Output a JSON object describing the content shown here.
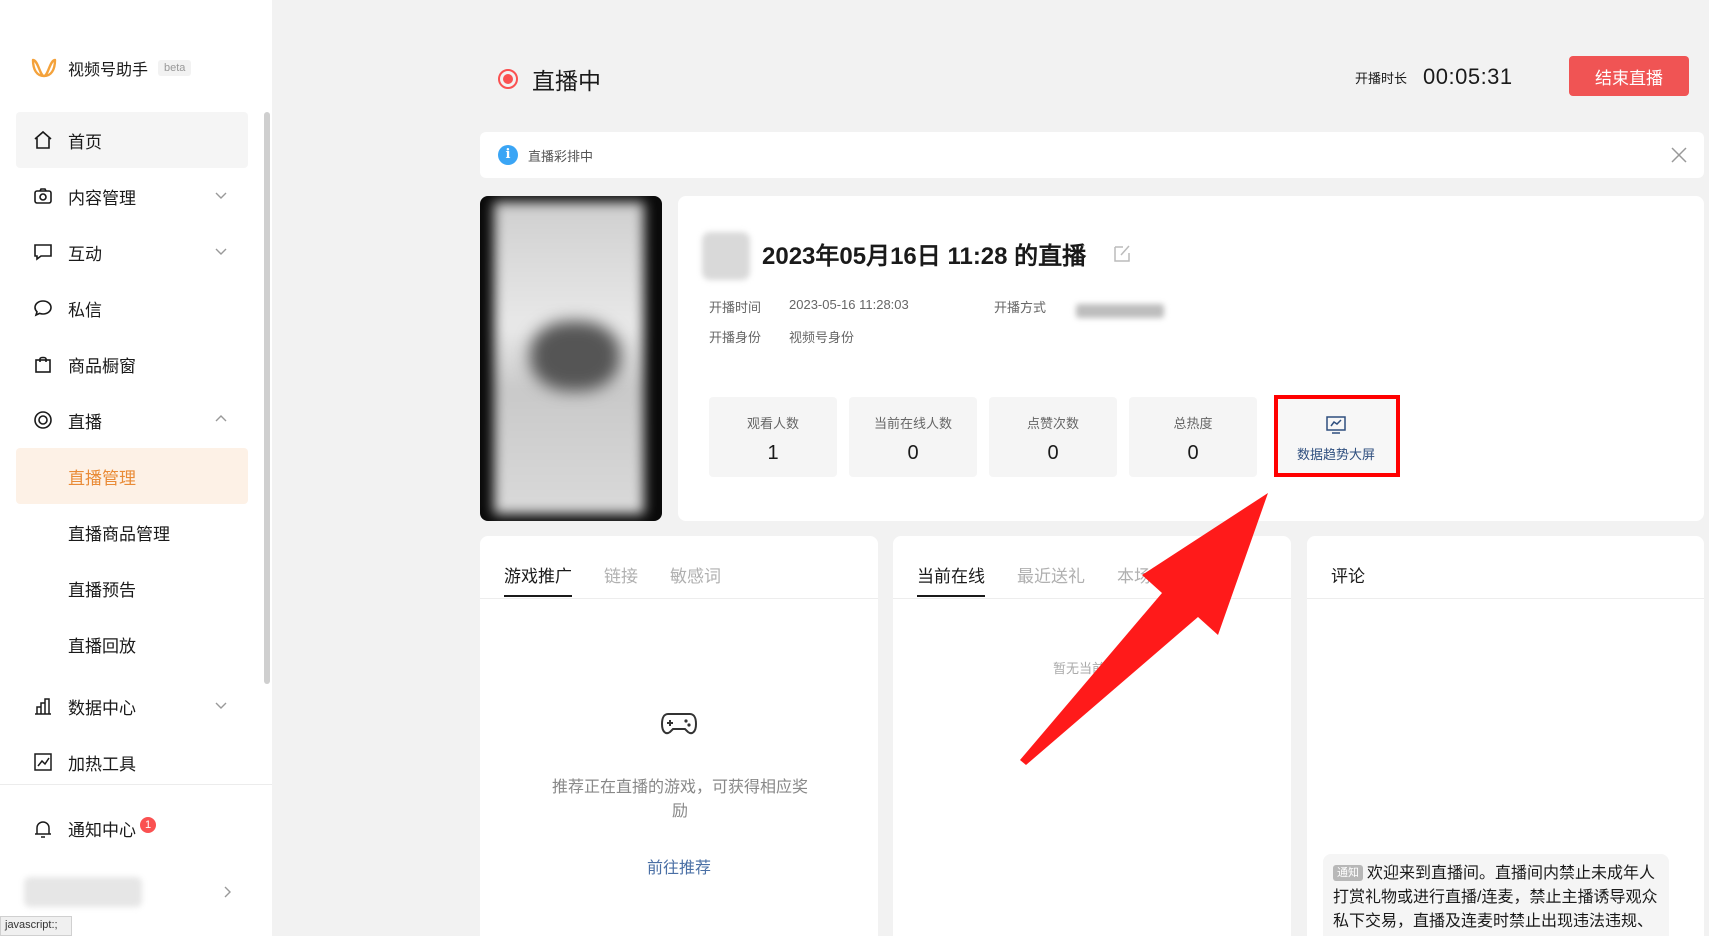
{
  "brand": {
    "name": "视频号助手",
    "beta": "beta"
  },
  "sidebar": {
    "items": [
      {
        "label": "首页"
      },
      {
        "label": "内容管理"
      },
      {
        "label": "互动"
      },
      {
        "label": "私信"
      },
      {
        "label": "商品橱窗"
      },
      {
        "label": "直播"
      }
    ],
    "live_sub": [
      {
        "label": "直播管理"
      },
      {
        "label": "直播商品管理"
      },
      {
        "label": "直播预告"
      },
      {
        "label": "直播回放"
      }
    ],
    "items_after": [
      {
        "label": "数据中心"
      },
      {
        "label": "加热工具"
      }
    ],
    "notify": {
      "label": "通知中心",
      "badge": "1"
    }
  },
  "statusbar": "javascript:;",
  "header": {
    "status": "直播中",
    "duration_label": "开播时长",
    "duration": "00:05:31",
    "end_button": "结束直播"
  },
  "notice": {
    "text": "直播彩排中"
  },
  "stream": {
    "title": "2023年05月16日 11:28 的直播",
    "start_time_label": "开播时间",
    "start_time": "2023-05-16 11:28:03",
    "start_mode_label": "开播方式",
    "identity_label": "开播身份",
    "identity": "视频号身份"
  },
  "stats": [
    {
      "label": "观看人数",
      "value": "1"
    },
    {
      "label": "当前在线人数",
      "value": "0"
    },
    {
      "label": "点赞次数",
      "value": "0"
    },
    {
      "label": "总热度",
      "value": "0"
    }
  ],
  "trend_button": "数据趋势大屏",
  "game_panel": {
    "tabs": [
      "游戏推广",
      "链接",
      "敏感词"
    ],
    "empty_text": "推荐正在直播的游戏，可获得相应奖励",
    "link": "前往推荐"
  },
  "online_panel": {
    "tabs": [
      "当前在线",
      "最近送礼",
      "本场送礼"
    ],
    "empty_text": "暂无当前在线"
  },
  "comment_panel": {
    "title": "评论",
    "notice_tag": "通知",
    "notice_text": "欢迎来到直播间。直播间内禁止未成年人打赏礼物或进行直播/连麦，禁止主播诱导观众私下交易，直播及连麦时禁止出现违法违规、色情低俗、诱导欺诈、抽烟喝酒等"
  },
  "colors": {
    "accent": "#e98b37",
    "danger": "#f05454",
    "info": "#3aa5f5",
    "annotation": "#ff0000"
  }
}
